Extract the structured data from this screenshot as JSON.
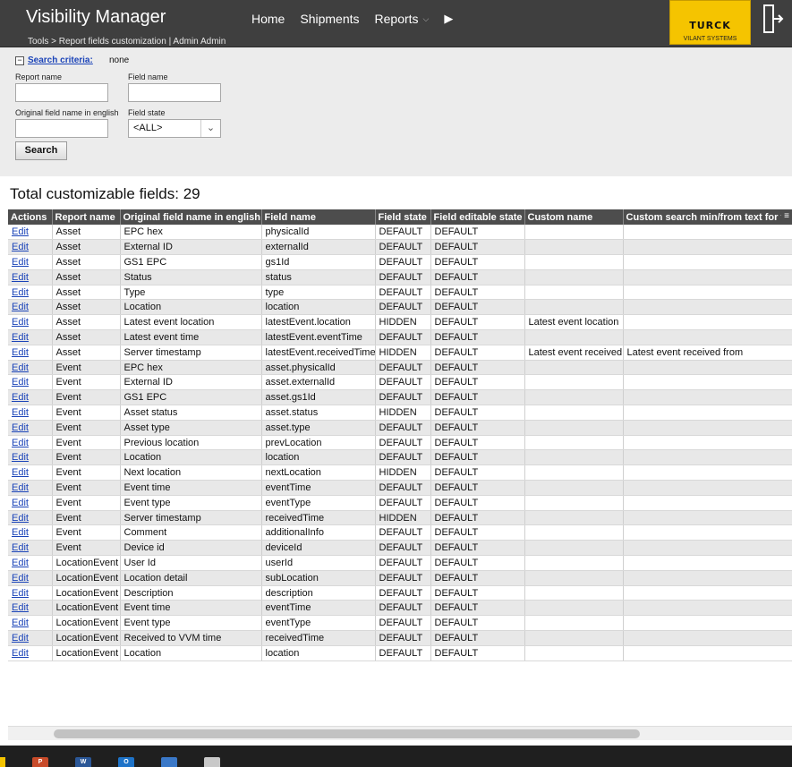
{
  "app": {
    "title": "Visibility Manager",
    "breadcrumb": "Tools > Report fields customization | Admin Admin",
    "nav": [
      {
        "label": "Home",
        "dropdown": false
      },
      {
        "label": "Shipments",
        "dropdown": false
      },
      {
        "label": "Reports",
        "dropdown": true
      }
    ],
    "nav_more_icon": "play-arrow-icon",
    "logo": {
      "brand": "TURCK",
      "sub": "VILANT SYSTEMS",
      "color": "#f5c400"
    },
    "exit_icon": "exit-door-icon"
  },
  "search": {
    "toggle_symbol": "−",
    "criteria_label": "Search criteria:",
    "criteria_value": "none",
    "fields": {
      "report_name": {
        "label": "Report name",
        "value": ""
      },
      "field_name": {
        "label": "Field name",
        "value": ""
      },
      "original_field_name": {
        "label": "Original field name in english",
        "value": ""
      },
      "field_state": {
        "label": "Field state",
        "selected": "<ALL>"
      }
    },
    "button_label": "Search"
  },
  "results": {
    "total_text": "Total customizable fields: 29",
    "columns": [
      "Actions",
      "Report name",
      "Original field name in english",
      "Field name",
      "Field state",
      "Field editable state",
      "Custom name",
      "Custom search min/from text for f"
    ],
    "header_menu_symbol": "≡",
    "edit_label": "Edit",
    "rows": [
      [
        "Asset",
        "EPC hex",
        "physicalId",
        "DEFAULT",
        "DEFAULT",
        "",
        ""
      ],
      [
        "Asset",
        "External ID",
        "externalId",
        "DEFAULT",
        "DEFAULT",
        "",
        ""
      ],
      [
        "Asset",
        "GS1 EPC",
        "gs1Id",
        "DEFAULT",
        "DEFAULT",
        "",
        ""
      ],
      [
        "Asset",
        "Status",
        "status",
        "DEFAULT",
        "DEFAULT",
        "",
        ""
      ],
      [
        "Asset",
        "Type",
        "type",
        "DEFAULT",
        "DEFAULT",
        "",
        ""
      ],
      [
        "Asset",
        "Location",
        "location",
        "DEFAULT",
        "DEFAULT",
        "",
        ""
      ],
      [
        "Asset",
        "Latest event location",
        "latestEvent.location",
        "HIDDEN",
        "DEFAULT",
        "Latest event location",
        ""
      ],
      [
        "Asset",
        "Latest event time",
        "latestEvent.eventTime",
        "DEFAULT",
        "DEFAULT",
        "",
        ""
      ],
      [
        "Asset",
        "Server timestamp",
        "latestEvent.receivedTime",
        "HIDDEN",
        "DEFAULT",
        "Latest event received",
        "Latest event received from"
      ],
      [
        "Event",
        "EPC hex",
        "asset.physicalId",
        "DEFAULT",
        "DEFAULT",
        "",
        ""
      ],
      [
        "Event",
        "External ID",
        "asset.externalId",
        "DEFAULT",
        "DEFAULT",
        "",
        ""
      ],
      [
        "Event",
        "GS1 EPC",
        "asset.gs1Id",
        "DEFAULT",
        "DEFAULT",
        "",
        ""
      ],
      [
        "Event",
        "Asset status",
        "asset.status",
        "HIDDEN",
        "DEFAULT",
        "",
        ""
      ],
      [
        "Event",
        "Asset type",
        "asset.type",
        "DEFAULT",
        "DEFAULT",
        "",
        ""
      ],
      [
        "Event",
        "Previous location",
        "prevLocation",
        "DEFAULT",
        "DEFAULT",
        "",
        ""
      ],
      [
        "Event",
        "Location",
        "location",
        "DEFAULT",
        "DEFAULT",
        "",
        ""
      ],
      [
        "Event",
        "Next location",
        "nextLocation",
        "HIDDEN",
        "DEFAULT",
        "",
        ""
      ],
      [
        "Event",
        "Event time",
        "eventTime",
        "DEFAULT",
        "DEFAULT",
        "",
        ""
      ],
      [
        "Event",
        "Event type",
        "eventType",
        "DEFAULT",
        "DEFAULT",
        "",
        ""
      ],
      [
        "Event",
        "Server timestamp",
        "receivedTime",
        "HIDDEN",
        "DEFAULT",
        "",
        ""
      ],
      [
        "Event",
        "Comment",
        "additionalInfo",
        "DEFAULT",
        "DEFAULT",
        "",
        ""
      ],
      [
        "Event",
        "Device id",
        "deviceId",
        "DEFAULT",
        "DEFAULT",
        "",
        ""
      ],
      [
        "LocationEvent",
        "User Id",
        "userId",
        "DEFAULT",
        "DEFAULT",
        "",
        ""
      ],
      [
        "LocationEvent",
        "Location detail",
        "subLocation",
        "DEFAULT",
        "DEFAULT",
        "",
        ""
      ],
      [
        "LocationEvent",
        "Description",
        "description",
        "DEFAULT",
        "DEFAULT",
        "",
        ""
      ],
      [
        "LocationEvent",
        "Event time",
        "eventTime",
        "DEFAULT",
        "DEFAULT",
        "",
        ""
      ],
      [
        "LocationEvent",
        "Event type",
        "eventType",
        "DEFAULT",
        "DEFAULT",
        "",
        ""
      ],
      [
        "LocationEvent",
        "Received to VVM time",
        "receivedTime",
        "DEFAULT",
        "DEFAULT",
        "",
        ""
      ],
      [
        "LocationEvent",
        "Location",
        "location",
        "DEFAULT",
        "DEFAULT",
        "",
        ""
      ]
    ]
  },
  "taskbar": {
    "icons": [
      {
        "name": "powerpoint-icon",
        "glyph": "P",
        "color": "#c84b2a"
      },
      {
        "name": "word-icon",
        "glyph": "W",
        "color": "#2b5797"
      },
      {
        "name": "outlook-icon",
        "glyph": "O",
        "color": "#1e73c8"
      },
      {
        "name": "window-app-icon",
        "glyph": "",
        "color": "#3a78c8"
      },
      {
        "name": "network-tool-icon",
        "glyph": "",
        "color": "#c8c8c8"
      }
    ]
  }
}
